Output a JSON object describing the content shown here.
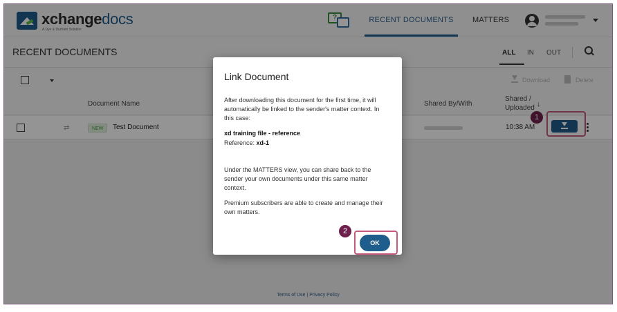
{
  "header": {
    "logo_brand": "xchange",
    "logo_docs": "docs",
    "logo_tagline": "A Dye & Durham Solution",
    "chat_icon_glyph": "?",
    "nav_recent": "RECENT DOCUMENTS",
    "nav_matters": "MATTERS"
  },
  "titlebar": {
    "title": "RECENT DOCUMENTS",
    "filter_all": "ALL",
    "filter_in": "IN",
    "filter_out": "OUT"
  },
  "toolbar": {
    "download_label": "Download",
    "delete_label": "Delete"
  },
  "table": {
    "col_document_name": "Document Name",
    "col_shared_by": "Shared By/With",
    "col_shared_line1": "Shared /",
    "col_shared_line2": "Uploaded",
    "sort_glyph": "↓",
    "rows": [
      {
        "badge": "NEW",
        "name": "Test Document",
        "time": "10:38 AM"
      }
    ]
  },
  "footer": {
    "terms": "Terms of Use",
    "separator": "|",
    "privacy": "Privacy Policy"
  },
  "modal": {
    "title": "Link Document",
    "para1": "After downloading this document for the first time, it will automatically be linked to the sender's matter context. In this case:",
    "matter_name": "xd training file - reference",
    "reference_label": "Reference: ",
    "reference_value": "xd-1",
    "para2": "Under the MATTERS view, you can share back to the sender your own documents under this same matter context.",
    "para3": "Premium subscribers are able to create and manage their own matters.",
    "ok_label": "OK"
  },
  "callouts": {
    "step1": "1",
    "step2": "2"
  },
  "colors": {
    "brand_blue": "#1f5d8c",
    "highlight": "#c55a7d",
    "badge": "#6e1f4b"
  }
}
